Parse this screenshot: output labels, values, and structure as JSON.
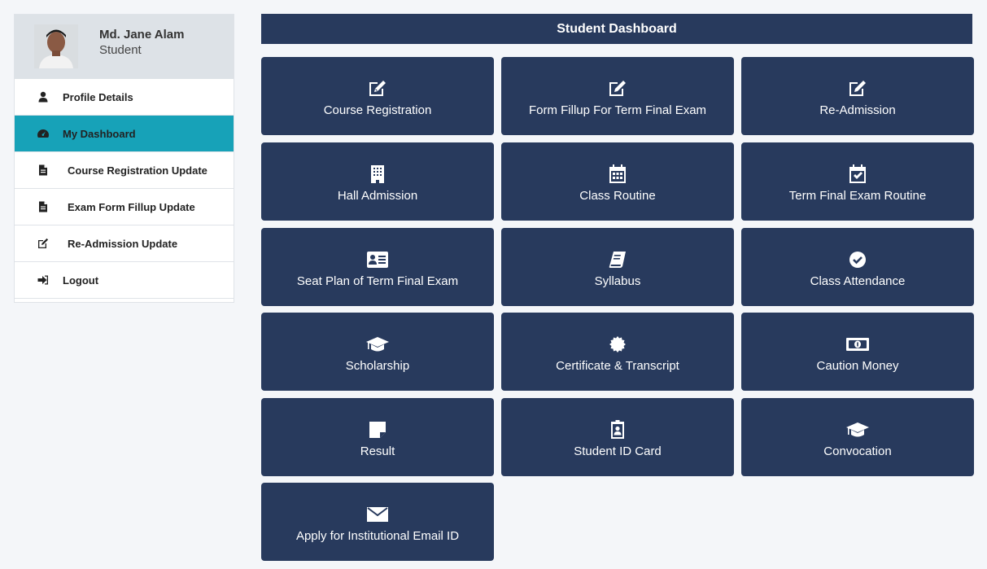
{
  "profile": {
    "name": "Md. Jane Alam",
    "role": "Student"
  },
  "sidebar": {
    "items": [
      {
        "label": "Profile Details",
        "icon": "user-icon"
      },
      {
        "label": "My Dashboard",
        "icon": "dashboard-icon",
        "active": true
      },
      {
        "label": "Course Registration Update",
        "icon": "file-icon"
      },
      {
        "label": "Exam Form Fillup Update",
        "icon": "file-icon"
      },
      {
        "label": "Re-Admission Update",
        "icon": "edit-icon"
      },
      {
        "label": "Logout",
        "icon": "sign-out-icon"
      }
    ]
  },
  "header": {
    "title": "Student Dashboard"
  },
  "tiles": [
    {
      "label": "Course Registration",
      "icon": "edit-icon"
    },
    {
      "label": "Form Fillup For Term Final Exam",
      "icon": "edit-icon"
    },
    {
      "label": "Re-Admission",
      "icon": "edit-icon"
    },
    {
      "label": "Hall Admission",
      "icon": "building-icon"
    },
    {
      "label": "Class Routine",
      "icon": "calendar-icon"
    },
    {
      "label": "Term Final Exam Routine",
      "icon": "calendar-check-icon"
    },
    {
      "label": "Seat Plan of Term Final Exam",
      "icon": "id-card-icon"
    },
    {
      "label": "Syllabus",
      "icon": "book-icon"
    },
    {
      "label": "Class Attendance",
      "icon": "check-circle-icon"
    },
    {
      "label": "Scholarship",
      "icon": "graduation-cap-icon"
    },
    {
      "label": "Certificate & Transcript",
      "icon": "certificate-icon"
    },
    {
      "label": "Caution Money",
      "icon": "money-icon"
    },
    {
      "label": "Result",
      "icon": "sticky-note-icon"
    },
    {
      "label": "Student ID Card",
      "icon": "id-badge-icon"
    },
    {
      "label": "Convocation",
      "icon": "graduation-cap-icon"
    },
    {
      "label": "Apply for Institutional Email ID",
      "icon": "envelope-icon"
    }
  ],
  "colors": {
    "navy": "#283a5d",
    "active": "#17a2b8",
    "profile_bg": "#dde2e7",
    "page_bg": "#f4f6f9"
  }
}
